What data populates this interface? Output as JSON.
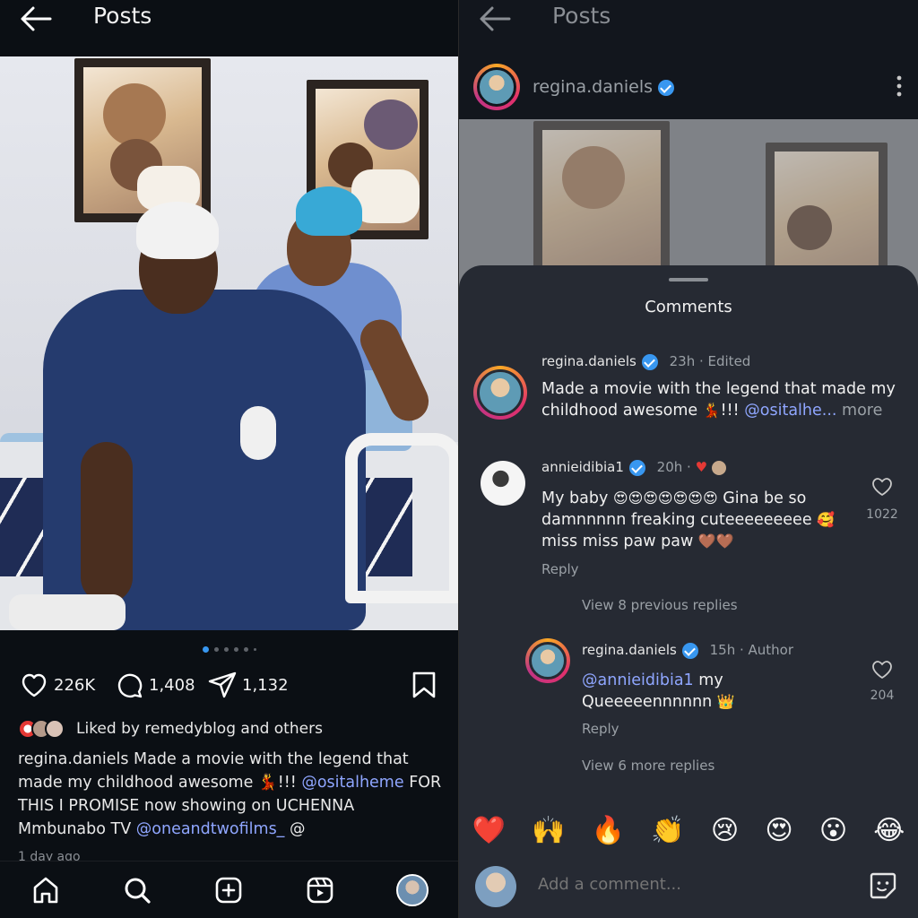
{
  "left": {
    "header": {
      "title": "Posts"
    },
    "post": {
      "dots_count": 6,
      "active_dot": 0,
      "likes_count": "226K",
      "comments_count": "1,408",
      "shares_count": "1,132",
      "liked_by": "Liked by remedyblog and others",
      "caption_user": "regina.daniels",
      "caption_text_1": " Made a movie with the legend that made my childhood awesome ",
      "caption_emoji_1": "💃",
      "caption_text_2": "!!! ",
      "caption_mention_1": "@ositalheme",
      "caption_text_3": " FOR THIS I PROMISE now showing on UCHENNA Mmbunabo TV ",
      "caption_mention_2": "@oneandtwofilms_",
      "caption_text_4": " @",
      "time": "1 day ago"
    },
    "nav": {
      "home_icon": "home-icon",
      "search_icon": "search-icon",
      "create_icon": "plus-square-icon",
      "reels_icon": "reels-icon"
    }
  },
  "right": {
    "header": {
      "title": "Posts"
    },
    "profile": {
      "username": "regina.daniels"
    },
    "sheet": {
      "title": "Comments",
      "comments": [
        {
          "user": "regina.daniels",
          "time": "23h",
          "edited": "· Edited",
          "text_1": "Made a movie with the legend that made my childhood awesome ",
          "emoji": "💃",
          "text_2": "!!! ",
          "mention": "@ositalhe...",
          "more": " more"
        },
        {
          "user": "annieidibia1",
          "time": "20h",
          "separator": "·",
          "text_1": "My baby ",
          "emojis_1": "😍😍😍😍😍😍😍",
          "text_2": " Gina be so damnnnnn freaking cuteeeeeeeee ",
          "emoji_2": "🥰",
          "text_3": " miss miss paw paw ",
          "emojis_3": "🤎🤎",
          "reply": "Reply",
          "like_count": "1022"
        },
        {
          "view_previous": "View 8 previous replies"
        },
        {
          "user": "regina.daniels",
          "time": "15h",
          "author": "· Author",
          "mention": "@annieidibia1",
          "text_1": " my Queeeeennnnnn ",
          "emoji": "👑",
          "reply": "Reply",
          "like_count": "204"
        },
        {
          "view_more": "View 6 more replies"
        }
      ],
      "reactions": [
        "❤️",
        "🙌",
        "🔥",
        "👏",
        "😢",
        "😍",
        "😮",
        "😂"
      ],
      "add_comment_placeholder": "Add a comment..."
    }
  },
  "colors": {
    "accent_blue": "#3897f0",
    "mention_blue": "#8fa6ff",
    "sheet_bg": "#262a33",
    "feed_bg": "#0b0f14"
  }
}
